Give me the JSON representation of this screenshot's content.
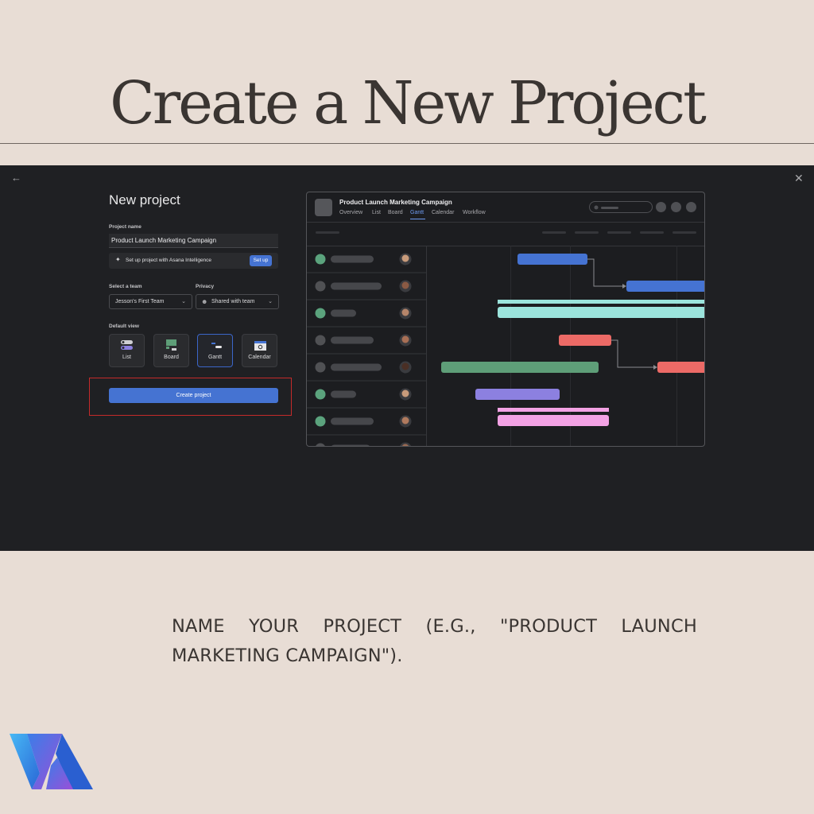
{
  "header": {
    "title": "Create a New Project"
  },
  "dialog": {
    "back_icon": "arrow-left-icon",
    "close_icon": "close-icon",
    "title": "New project",
    "project_name_label": "Project name",
    "project_name_value": "Product Launch Marketing Campaign",
    "ai_setup_text": "Set up project with Asana Intelligence",
    "ai_setup_button": "Set up",
    "team_label": "Select a team",
    "team_value": "Jesson's First Team",
    "privacy_label": "Privacy",
    "privacy_value": "Shared with team",
    "default_view_label": "Default view",
    "views": [
      {
        "label": "List",
        "icon": "list-icon",
        "selected": false
      },
      {
        "label": "Board",
        "icon": "board-icon",
        "selected": false
      },
      {
        "label": "Gantt",
        "icon": "gantt-icon",
        "selected": true
      },
      {
        "label": "Calendar",
        "icon": "calendar-icon",
        "selected": false
      }
    ],
    "create_button": "Create project"
  },
  "preview": {
    "project_title": "Product Launch Marketing Campaign",
    "tabs": [
      "Overview",
      "List",
      "Board",
      "Gantt",
      "Calendar",
      "Workflow"
    ],
    "active_tab": "Gantt",
    "status_colors": [
      "#5ba37d",
      "#505154",
      "#5ba37d",
      "#505154",
      "#505154",
      "#5ba37d",
      "#5ba37d",
      "#505154"
    ],
    "bar_colors": {
      "blue": "#4573d2",
      "teal": "#9be4dc",
      "red": "#ec6a66",
      "green": "#5e9e78",
      "purple": "#8c80e0",
      "pink": "#f3a2e4"
    }
  },
  "caption": "NAME YOUR PROJECT (E.G., \"PRODUCT LAUNCH MARKETING CAMPAIGN\").",
  "logo": {
    "icon": "brand-logo-icon"
  }
}
